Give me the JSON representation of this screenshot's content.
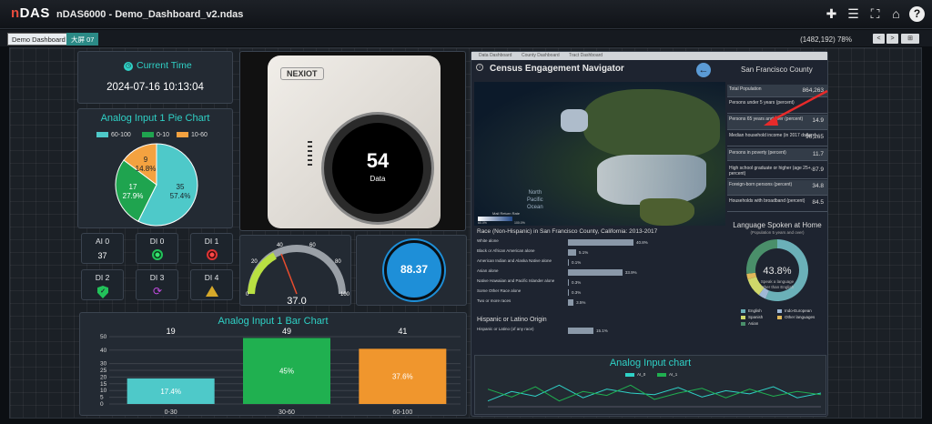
{
  "app": {
    "logo_prefix": "n",
    "logo_suffix": "DAS",
    "title": "nDAS6000 - Demo_Dashboard_v2.ndas"
  },
  "toolbar": {
    "icons": [
      "drop-icon",
      "list-icon",
      "fullscreen-icon",
      "home-icon",
      "help-icon"
    ]
  },
  "tabs": [
    {
      "label": "Demo Dashboard"
    },
    {
      "label": "大屏 07"
    }
  ],
  "status": {
    "cursor_zoom": "(1482,192) 78%",
    "prev": "<",
    "next": ">",
    "fit": "⊞"
  },
  "time_panel": {
    "title": "Current Time",
    "value": "2024-07-16 10:13:04"
  },
  "pie": {
    "title": "Analog Input 1 Pie Chart",
    "legend": [
      "60-100",
      "0-10",
      "10-60"
    ],
    "labels": [
      {
        "value": "35",
        "pct": "57.4%"
      },
      {
        "value": "17",
        "pct": "27.9%"
      },
      {
        "value": "9",
        "pct": "14.8%"
      }
    ]
  },
  "device": {
    "brand": "NEXIOT",
    "reading": "54",
    "caption": "Data"
  },
  "digital": [
    {
      "label": "AI 0",
      "value": "37"
    },
    {
      "label": "DI 0"
    },
    {
      "label": "DI 1"
    },
    {
      "label": "DI 2"
    },
    {
      "label": "DI 3"
    },
    {
      "label": "DI 4"
    }
  ],
  "gauge": {
    "value": "37.0",
    "ticks": [
      "0",
      "20",
      "40",
      "60",
      "80",
      "100"
    ]
  },
  "tank": {
    "value": "88.37"
  },
  "bar_chart": {
    "title": "Analog Input 1 Bar Chart",
    "yticks": [
      "0",
      "5",
      "10",
      "15",
      "20",
      "25",
      "30",
      "40",
      "50"
    ]
  },
  "census": {
    "tabs": [
      "Data Dashboard",
      "County Dashboard",
      "Tract Dashboard"
    ],
    "title": "Census Engagement Navigator",
    "county": "San Francisco County",
    "map_labels": {
      "ocean1": "North",
      "ocean2": "Pacific",
      "ocean3": "Ocean",
      "legend": "Mail Return Rate",
      "lo": "60.0%",
      "hi": "100.0%"
    },
    "stats": [
      {
        "label": "Total Population",
        "value": "864,263"
      },
      {
        "label": "Persons under 5 years (percent)",
        "value": ""
      },
      {
        "label": "Persons 65 years and over (percent)",
        "value": "14.9"
      },
      {
        "label": "Median household income (in 2017 dollars)",
        "value": "96,265"
      },
      {
        "label": "Persons in poverty (percent)",
        "value": "11.7"
      },
      {
        "label": "High school graduate or higher (age 25+, percent)",
        "value": "87.9"
      },
      {
        "label": "Foreign-born persons (percent)",
        "value": "34.8"
      },
      {
        "label": "Households with broadband (percent)",
        "value": "84.5"
      }
    ],
    "race_title": "Race (Non-Hispanic) in San Francisco County, California: 2013-2017",
    "race_rows": [
      {
        "label": "White alone",
        "pct": "40.8%"
      },
      {
        "label": "Black or African American alone",
        "pct": "5.1%"
      },
      {
        "label": "American Indian and Alaska Native alone",
        "pct": "0.1%"
      },
      {
        "label": "Asian alone",
        "pct": "33.9%"
      },
      {
        "label": "Native Hawaiian and Pacific Islander alone",
        "pct": "0.3%"
      },
      {
        "label": "Some Other Race alone",
        "pct": "0.3%"
      },
      {
        "label": "Two or more races",
        "pct": "3.5%"
      }
    ],
    "hispanic_title": "Hispanic or Latino Origin",
    "hispanic_row": {
      "label": "Hispanic or Latino (of any race)",
      "pct": "15.1%"
    },
    "lang": {
      "title": "Language Spoken at Home",
      "subtitle": "(Population 5 years and over)",
      "center": "43.8%",
      "caption1": "Speak a language",
      "caption2": "other than English",
      "legend": [
        "English",
        "Indo-European",
        "Spanish",
        "Other languages",
        "Asian"
      ]
    }
  },
  "line_chart": {
    "title": "Analog Input chart",
    "legend": [
      "AI_0",
      "AI_1"
    ]
  },
  "colors": {
    "teal": "#2fd1c6",
    "pie_teal": "#4ec9c9",
    "pie_green": "#1fa44f",
    "pie_orange": "#f4a240",
    "bar_green": "#20b050",
    "bar_orange": "#f0962d",
    "bar_teal": "#4ec9c9"
  },
  "chart_data": [
    {
      "type": "pie",
      "title": "Analog Input 1 Pie Chart",
      "categories": [
        "60-100",
        "0-10",
        "10-60"
      ],
      "values": [
        35,
        17,
        9
      ],
      "percents": [
        57.4,
        27.9,
        14.8
      ]
    },
    {
      "type": "bar",
      "title": "Analog Input 1 Bar Chart",
      "categories": [
        "0-30",
        "30-60",
        "60-100"
      ],
      "values": [
        19,
        49,
        41
      ],
      "labels": [
        "17.4%",
        "45%",
        "37.6%"
      ],
      "ylim": [
        0,
        50
      ],
      "yticks": [
        0,
        5,
        10,
        15,
        20,
        25,
        30,
        40,
        50
      ]
    },
    {
      "type": "bar",
      "title": "Race (Non-Hispanic) in San Francisco County, California: 2013-2017",
      "categories": [
        "White alone",
        "Black or African American alone",
        "American Indian and Alaska Native alone",
        "Asian alone",
        "Native Hawaiian and Pacific Islander alone",
        "Some Other Race alone",
        "Two or more races"
      ],
      "values": [
        40.8,
        5.1,
        0.1,
        33.9,
        0.3,
        0.3,
        3.5
      ]
    },
    {
      "type": "pie",
      "title": "Language Spoken at Home",
      "categories": [
        "English",
        "Indo-European",
        "Spanish",
        "Other languages",
        "Asian"
      ],
      "values": [
        56.2,
        4,
        10,
        3,
        26.8
      ]
    },
    {
      "type": "line",
      "title": "Analog Input chart",
      "series": [
        {
          "name": "AI_0",
          "values": [
            40,
            52,
            46,
            60,
            44,
            55,
            50,
            48,
            57,
            45,
            53,
            49,
            58,
            44,
            50
          ]
        },
        {
          "name": "AI_1",
          "values": [
            55,
            45,
            58,
            40,
            52,
            47,
            60,
            42,
            50,
            56,
            44,
            55,
            46,
            52,
            48
          ]
        }
      ]
    }
  ]
}
